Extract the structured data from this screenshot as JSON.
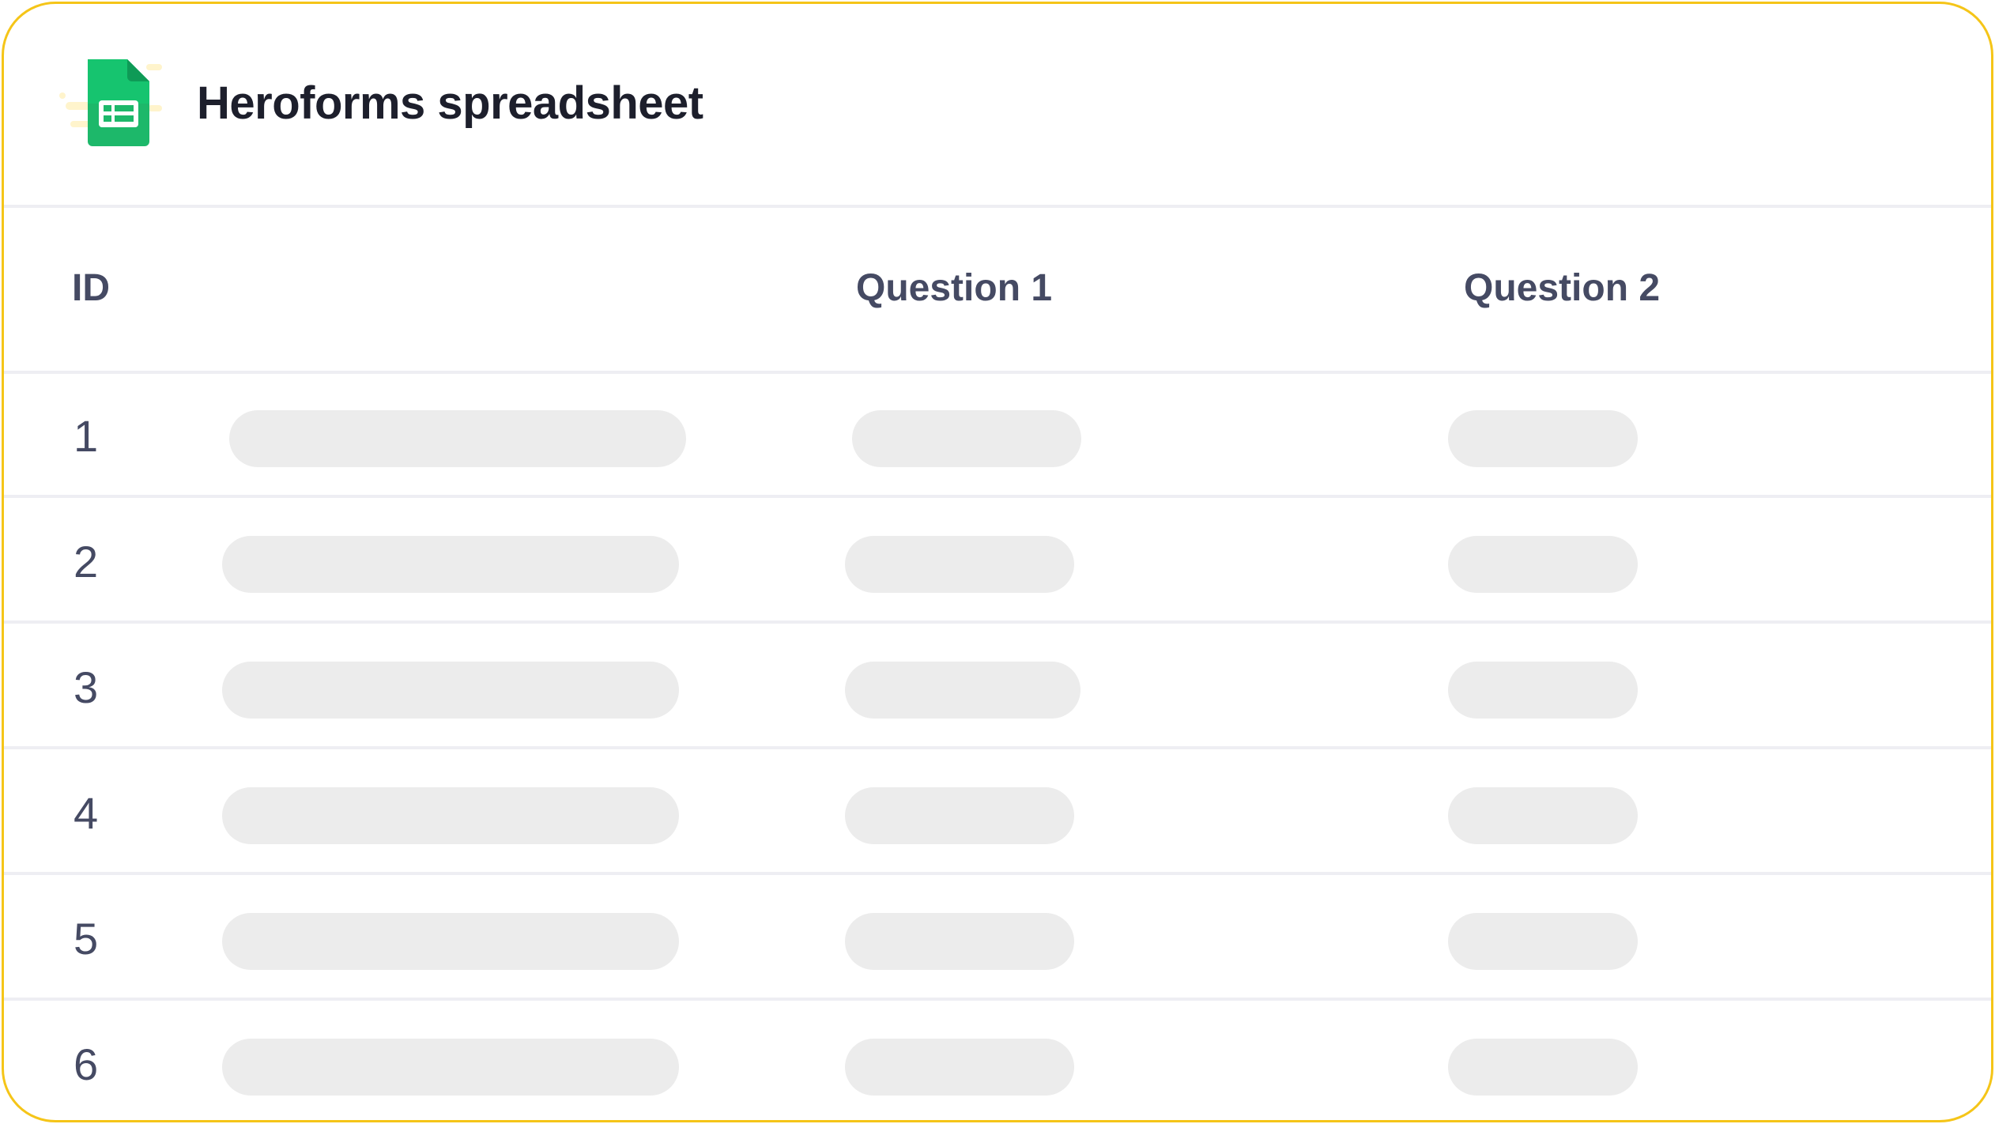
{
  "colors": {
    "border_accent": "#F5C518",
    "title_text": "#1D1F2C",
    "header_text": "#454A63",
    "placeholder_fill": "#ECECEC",
    "divider": "#EEEEF3",
    "logo_green": "#1DB86A"
  },
  "header": {
    "logo_icon": "google-sheets-icon",
    "title": "Heroforms spreadsheet"
  },
  "table": {
    "columns": [
      "ID",
      "Question 1",
      "Question 2"
    ],
    "rows": [
      {
        "id": "1"
      },
      {
        "id": "2"
      },
      {
        "id": "3"
      },
      {
        "id": "4"
      },
      {
        "id": "5"
      },
      {
        "id": "6"
      }
    ]
  }
}
